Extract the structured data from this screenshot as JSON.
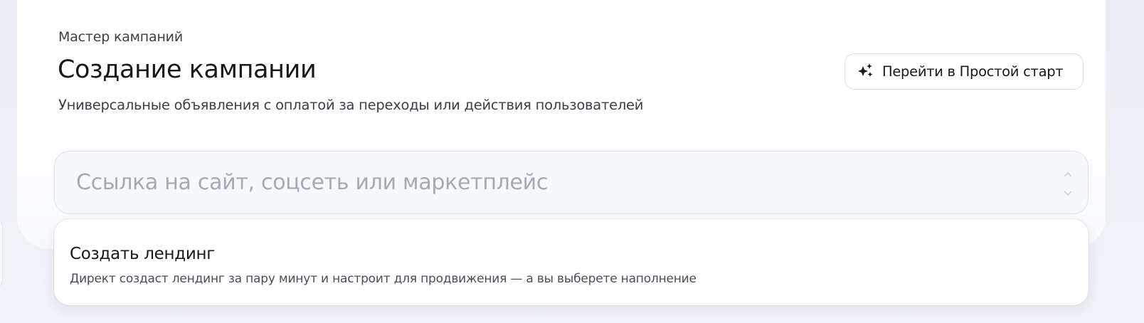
{
  "header": {
    "breadcrumb": "Мастер кампаний",
    "title": "Создание кампании",
    "subtitle": "Универсальные объявления с оплатой за переходы или действия пользователей"
  },
  "actions": {
    "simple_start_label": "Перейти в Простой старт",
    "simple_start_icon": "sparkles-icon"
  },
  "url_field": {
    "value": "",
    "placeholder": "Ссылка на сайт, соцсеть или маркетплейс"
  },
  "suggestion": {
    "title": "Создать лендинг",
    "description": "Директ создаст лендинг за пару минут и настроит для продвижения — а вы выберете наполнение"
  },
  "colors": {
    "background": "#eef0f6",
    "card": "#ffffff",
    "text_primary": "#17181c",
    "text_secondary": "#3c3f48",
    "placeholder": "#a4a9b6",
    "border": "#dcdfe6"
  }
}
